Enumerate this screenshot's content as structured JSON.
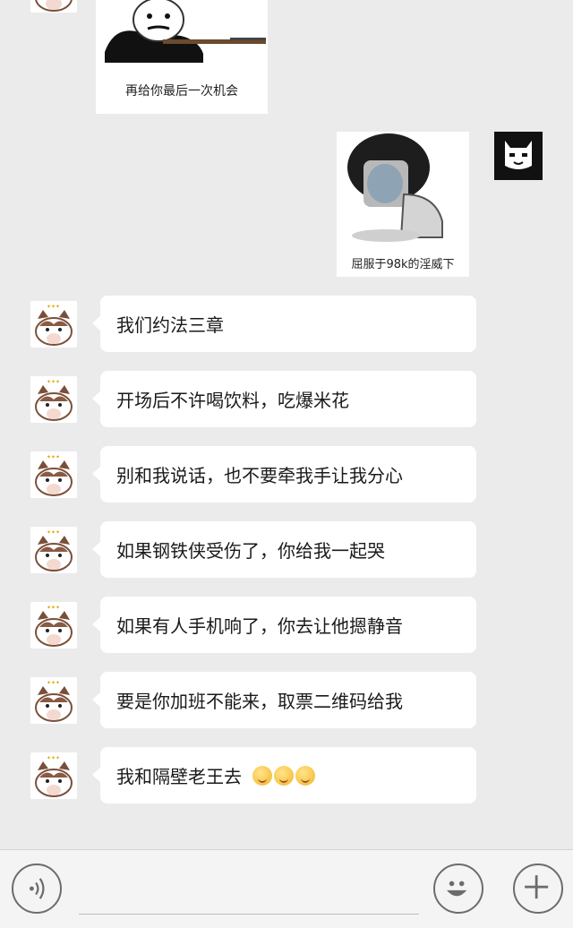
{
  "stickers": {
    "top_caption": "再给你最后一次机会",
    "right_caption": "屈服于98k的淫威下"
  },
  "messages": [
    {
      "text": "我们约法三章"
    },
    {
      "text": "开场后不许喝饮料，吃爆米花"
    },
    {
      "text": "别和我说话，也不要牵我手让我分心"
    },
    {
      "text": "如果钢铁侠受伤了，你给我一起哭"
    },
    {
      "text": "如果有人手机响了，你去让他摁静音"
    },
    {
      "text": "要是你加班不能来，取票二维码给我"
    },
    {
      "text": "我和隔壁老王去"
    }
  ],
  "input": {
    "value": ""
  },
  "colors": {
    "chat_bg": "#ebebeb",
    "bubble": "#ffffff",
    "toolbar_bg": "#f4f4f4",
    "icon": "#6c6c6c"
  },
  "icons": {
    "voice": "voice-icon",
    "emoji": "emoji-icon",
    "add": "plus-icon"
  }
}
